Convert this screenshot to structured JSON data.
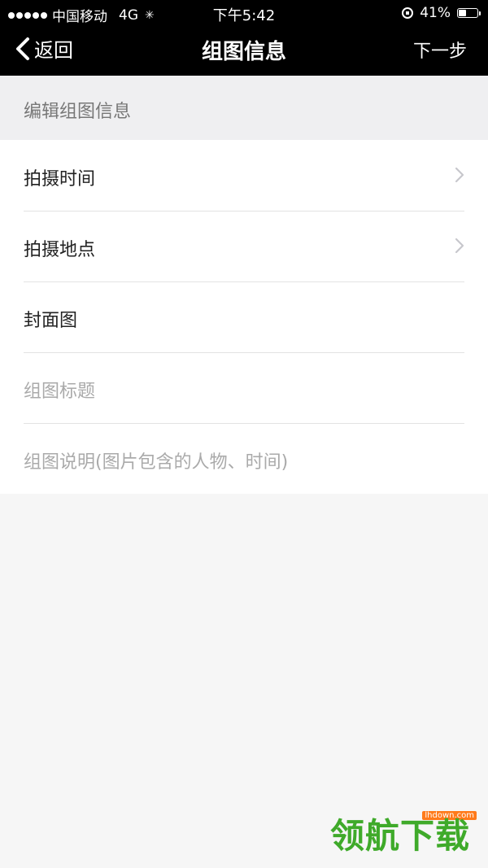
{
  "status_bar": {
    "carrier": "中国移动",
    "network": "4G",
    "time": "下午5:42",
    "battery": "41%",
    "battery_level": 0.41
  },
  "nav": {
    "back_label": "返回",
    "title": "组图信息",
    "next_label": "下一步"
  },
  "section": {
    "header": "编辑组图信息"
  },
  "list": {
    "items": [
      {
        "label": "拍摄时间"
      },
      {
        "label": "拍摄地点"
      },
      {
        "label": "封面图"
      },
      {
        "placeholder": "组图标题"
      },
      {
        "placeholder": "组图说明(图片包含的人物、时间)"
      }
    ]
  },
  "watermark": {
    "text": "领航下载",
    "url": "lhdown.com"
  }
}
